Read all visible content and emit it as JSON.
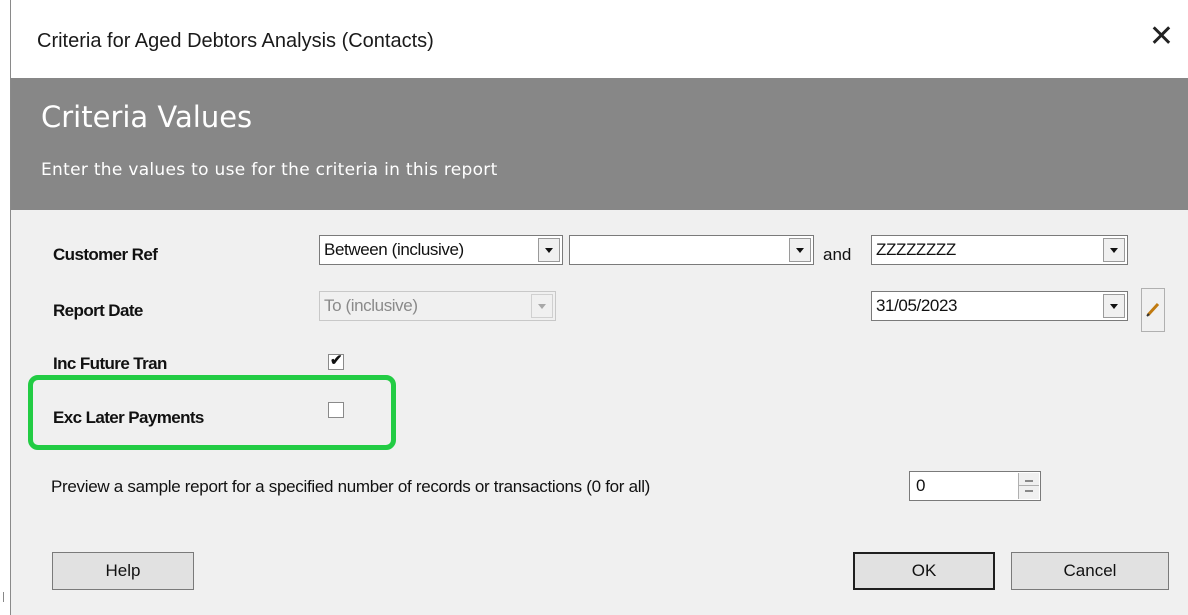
{
  "window": {
    "title": "Criteria for Aged Debtors Analysis (Contacts)",
    "close_glyph": "✕"
  },
  "banner": {
    "title": "Criteria Values",
    "subtitle": "Enter the values to use for the criteria in this report"
  },
  "criteria": {
    "customer_ref": {
      "label": "Customer Ref",
      "operator": "Between (inclusive)",
      "from_value": "",
      "and_label": "and",
      "to_value": "ZZZZZZZZ"
    },
    "report_date": {
      "label": "Report Date",
      "operator": "To (inclusive)",
      "value": "31/05/2023",
      "edit_icon": "pencil-icon"
    },
    "inc_future_tran": {
      "label": "Inc Future Tran",
      "checked": true,
      "tick": "✔"
    },
    "exc_later_payments": {
      "label": "Exc Later Payments",
      "checked": false,
      "highlight_color": "#22cc44"
    }
  },
  "preview": {
    "label": "Preview a sample report for a specified number of records or transactions (0 for all)",
    "value": "0"
  },
  "buttons": {
    "help": "Help",
    "ok": "OK",
    "cancel": "Cancel"
  },
  "colors": {
    "banner_bg": "#878787",
    "dialog_bg": "#f0f0f0"
  }
}
